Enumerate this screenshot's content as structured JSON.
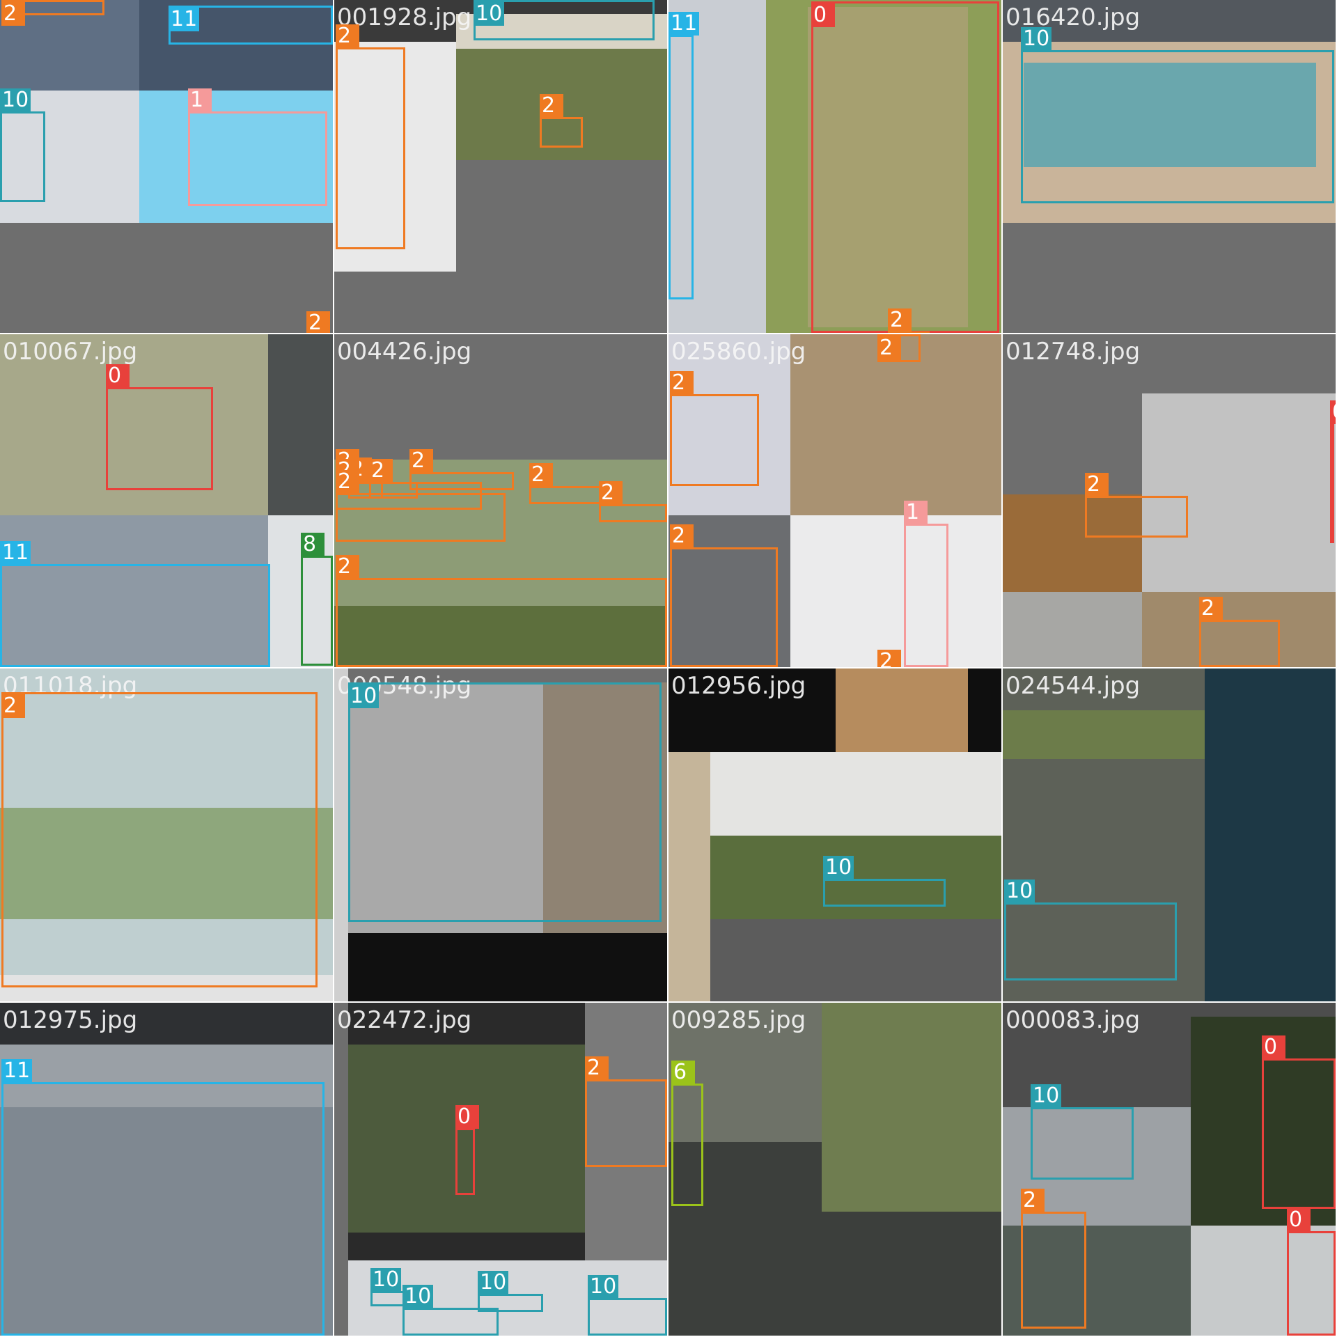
{
  "mosaic": {
    "title": "",
    "colors": {
      "0": "#e8413b",
      "1": "#f59a9a",
      "2": "#ef7a22",
      "6": "#9bc31a",
      "8": "#2d8f3a",
      "10": "#2a9fae",
      "11": "#27b4e6"
    },
    "tiles": [
      {
        "id": "t00",
        "name": "",
        "boxes": [
          {
            "cls": "2",
            "label": "2"
          },
          {
            "cls": "11",
            "label": "11"
          },
          {
            "cls": "10",
            "label": "10"
          },
          {
            "cls": "1",
            "label": "1"
          },
          {
            "cls": "2",
            "label": "2"
          }
        ]
      },
      {
        "id": "t01",
        "name": "001928.jpg",
        "boxes": [
          {
            "cls": "10",
            "label": "10"
          },
          {
            "cls": "2",
            "label": "2"
          },
          {
            "cls": "2",
            "label": "2"
          }
        ]
      },
      {
        "id": "t02",
        "name": "",
        "boxes": [
          {
            "cls": "11",
            "label": "11"
          },
          {
            "cls": "0",
            "label": "0"
          },
          {
            "cls": "2",
            "label": "2"
          }
        ]
      },
      {
        "id": "t03",
        "name": "016420.jpg",
        "boxes": [
          {
            "cls": "10",
            "label": "10"
          }
        ]
      },
      {
        "id": "t10",
        "name": "010067.jpg",
        "boxes": [
          {
            "cls": "0",
            "label": "0"
          },
          {
            "cls": "11",
            "label": "11"
          },
          {
            "cls": "8",
            "label": "8"
          }
        ]
      },
      {
        "id": "t11",
        "name": "004426.jpg",
        "boxes": [
          {
            "cls": "2",
            "label": "2"
          },
          {
            "cls": "2",
            "label": "2"
          },
          {
            "cls": "2",
            "label": "2"
          },
          {
            "cls": "2",
            "label": "2"
          },
          {
            "cls": "2",
            "label": "2"
          },
          {
            "cls": "2",
            "label": "2"
          },
          {
            "cls": "2",
            "label": "2"
          },
          {
            "cls": "2",
            "label": "2"
          },
          {
            "cls": "2",
            "label": "2"
          }
        ]
      },
      {
        "id": "t12",
        "name": "025860.jpg",
        "boxes": [
          {
            "cls": "2",
            "label": "2"
          },
          {
            "cls": "2",
            "label": "2"
          },
          {
            "cls": "1",
            "label": "1"
          },
          {
            "cls": "2",
            "label": "2"
          },
          {
            "cls": "2",
            "label": "2"
          }
        ]
      },
      {
        "id": "t13",
        "name": "012748.jpg",
        "boxes": [
          {
            "cls": "0",
            "label": "0"
          },
          {
            "cls": "2",
            "label": "2"
          },
          {
            "cls": "2",
            "label": "2"
          }
        ]
      },
      {
        "id": "t20",
        "name": "011018.jpg",
        "boxes": [
          {
            "cls": "2",
            "label": "2"
          }
        ]
      },
      {
        "id": "t21",
        "name": "000548.jpg",
        "boxes": [
          {
            "cls": "10",
            "label": "10"
          }
        ]
      },
      {
        "id": "t22",
        "name": "012956.jpg",
        "boxes": [
          {
            "cls": "10",
            "label": "10"
          }
        ]
      },
      {
        "id": "t23",
        "name": "024544.jpg",
        "boxes": [
          {
            "cls": "10",
            "label": "10"
          }
        ]
      },
      {
        "id": "t30",
        "name": "012975.jpg",
        "boxes": [
          {
            "cls": "11",
            "label": "11"
          }
        ]
      },
      {
        "id": "t31",
        "name": "022472.jpg",
        "boxes": [
          {
            "cls": "0",
            "label": "0"
          },
          {
            "cls": "2",
            "label": "2"
          },
          {
            "cls": "10",
            "label": "10"
          },
          {
            "cls": "10",
            "label": "10"
          },
          {
            "cls": "10",
            "label": "10"
          },
          {
            "cls": "10",
            "label": "10"
          }
        ]
      },
      {
        "id": "t32",
        "name": "009285.jpg",
        "boxes": [
          {
            "cls": "6",
            "label": "6"
          }
        ]
      },
      {
        "id": "t33",
        "name": "000083.jpg",
        "boxes": [
          {
            "cls": "10",
            "label": "10"
          },
          {
            "cls": "2",
            "label": "2"
          },
          {
            "cls": "0",
            "label": "0"
          },
          {
            "cls": "0",
            "label": "0"
          }
        ]
      }
    ]
  }
}
